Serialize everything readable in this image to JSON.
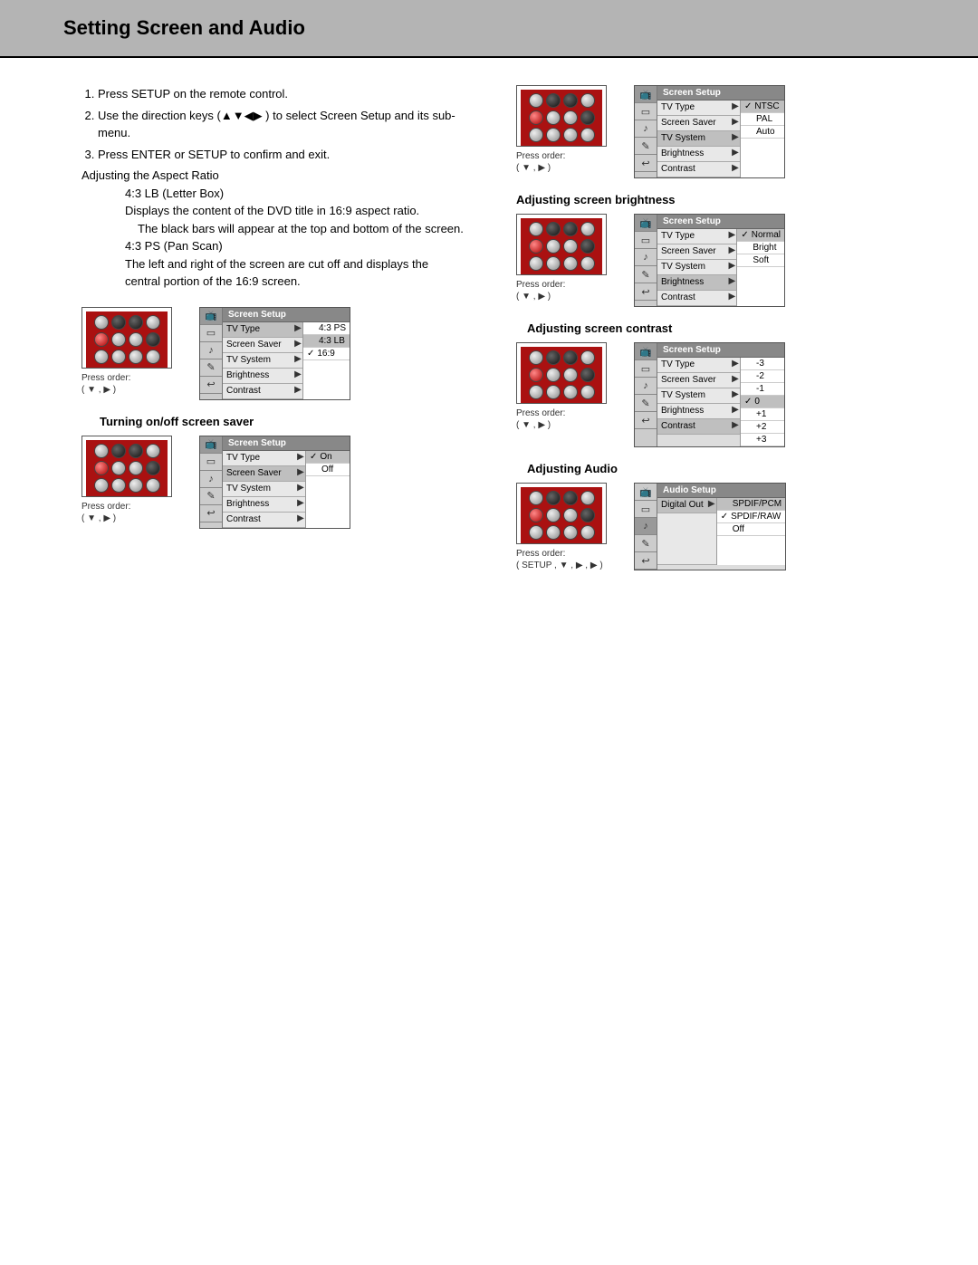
{
  "header": {
    "title": "Setting Screen and Audio"
  },
  "instructions": {
    "items": [
      "Press SETUP on the remote control.",
      "Use the direction keys (▲▼◀▶ ) to select Screen Setup and its sub-menu.",
      "Press ENTER or SETUP to confirm and exit."
    ],
    "aspect_heading": "Adjusting the Aspect Ratio",
    "lb_label": "4:3 LB (Letter Box)",
    "lb_desc1": "Displays the content of the DVD title in 16:9 aspect ratio.",
    "lb_desc2": "The black bars will appear at the top and bottom of the screen.",
    "ps_label": "4:3 PS (Pan Scan)",
    "ps_desc1": "The left and right of the screen are cut off and displays the",
    "ps_desc2": "central portion of the 16:9 screen."
  },
  "press_order_label": "Press order:",
  "press_order_dd": "( ▼ , ▶ )",
  "press_order_setup": "( SETUP , ▼ , ▶ , ▶ )",
  "sections": {
    "screensaver": "Turning on/off screen saver",
    "brightness": "Adjusting screen brightness",
    "contrast": "Adjusting screen contrast",
    "audio": "Adjusting Audio"
  },
  "osd": {
    "screen_title": "Screen Setup",
    "audio_title": "Audio Setup",
    "rows": {
      "tvtype": "TV Type",
      "screensaver": "Screen Saver",
      "tvsystem": "TV System",
      "brightness": "Brightness",
      "contrast": "Contrast",
      "digital_out": "Digital Out"
    },
    "opts": {
      "aspect": [
        "4:3 PS",
        "4:3 LB",
        "16:9"
      ],
      "onoff": [
        "On",
        "Off"
      ],
      "tvsys": [
        "NTSC",
        "PAL",
        "Auto"
      ],
      "bright": [
        "Normal",
        "Bright",
        "Soft"
      ],
      "contrast": [
        "-3",
        "-2",
        "-1",
        "0",
        "+1",
        "+2",
        "+3"
      ],
      "digital": [
        "SPDIF/PCM",
        "SPDIF/RAW",
        "Off"
      ]
    }
  }
}
